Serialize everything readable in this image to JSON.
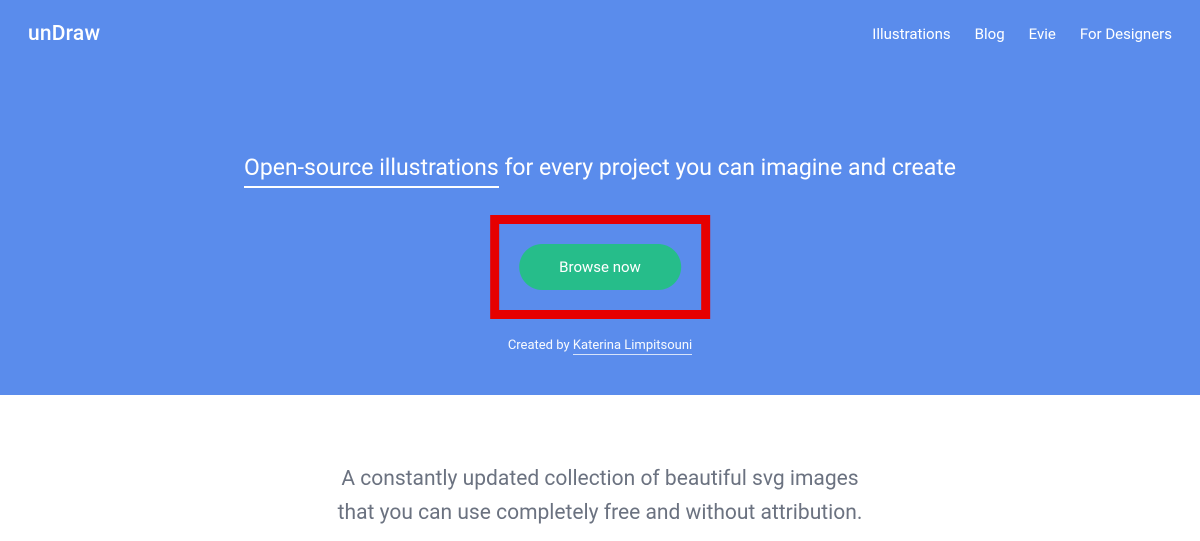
{
  "header": {
    "logo": "unDraw",
    "nav": [
      {
        "label": "Illustrations"
      },
      {
        "label": "Blog"
      },
      {
        "label": "Evie"
      },
      {
        "label": "For Designers"
      }
    ]
  },
  "hero": {
    "tagline_emphasis": "Open-source illustrations",
    "tagline_rest": " for every project you can imagine and create",
    "cta_label": "Browse now",
    "created_prefix": "Created by ",
    "created_author": "Katerina Limpitsouni"
  },
  "description": {
    "line1": "A constantly updated collection of beautiful svg images",
    "line2": "that you can use completely free and without attribution."
  },
  "annotation": {
    "highlight_color": "#e60000"
  }
}
